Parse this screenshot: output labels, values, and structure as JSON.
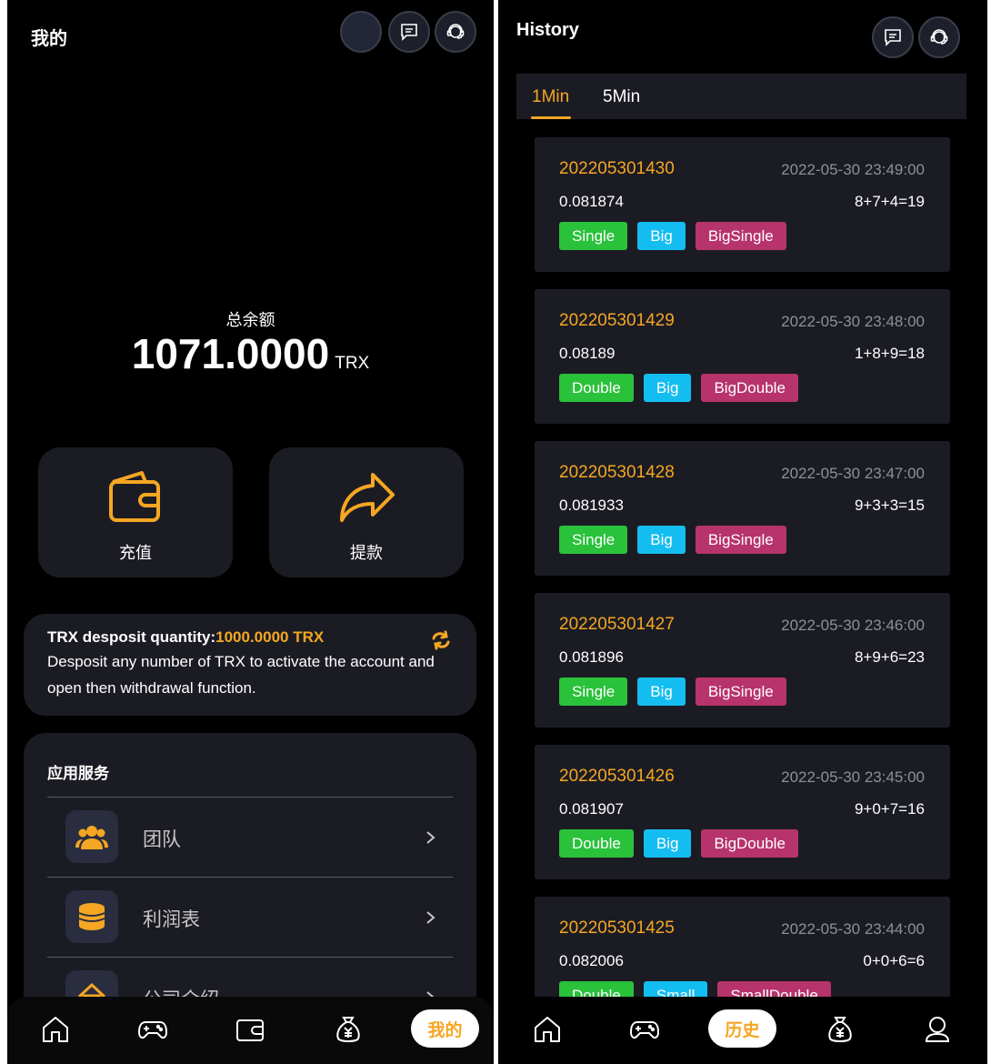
{
  "left": {
    "title": "我的",
    "balance": {
      "label": "总余额",
      "amount": "1071.0000",
      "unit": "TRX"
    },
    "actions": [
      {
        "label": "充值",
        "icon": "wallet-icon"
      },
      {
        "label": "提款",
        "icon": "share-arrow-icon"
      }
    ],
    "notice": {
      "title_prefix": "TRX desposit quantity:",
      "title_value": "1000.0000 TRX",
      "body": "Desposit any number of TRX to activate the account and open then withdrawal function."
    },
    "services": {
      "title": "应用服务",
      "items": [
        {
          "label": "团队",
          "icon": "team-icon"
        },
        {
          "label": "利润表",
          "icon": "coins-icon"
        },
        {
          "label": "公司介绍",
          "icon": "company-icon"
        }
      ]
    },
    "nav_active_label": "我的"
  },
  "right": {
    "title": "History",
    "tabs": [
      {
        "label": "1Min"
      },
      {
        "label": "5Min"
      }
    ],
    "records": [
      {
        "issue": "202205301430",
        "time": "2022-05-30 23:49:00",
        "hash": "0.081874",
        "sum": "8+7+4=19",
        "tags": [
          "Single",
          "Big",
          "BigSingle"
        ]
      },
      {
        "issue": "202205301429",
        "time": "2022-05-30 23:48:00",
        "hash": "0.08189",
        "sum": "1+8+9=18",
        "tags": [
          "Double",
          "Big",
          "BigDouble"
        ]
      },
      {
        "issue": "202205301428",
        "time": "2022-05-30 23:47:00",
        "hash": "0.081933",
        "sum": "9+3+3=15",
        "tags": [
          "Single",
          "Big",
          "BigSingle"
        ]
      },
      {
        "issue": "202205301427",
        "time": "2022-05-30 23:46:00",
        "hash": "0.081896",
        "sum": "8+9+6=23",
        "tags": [
          "Single",
          "Big",
          "BigSingle"
        ]
      },
      {
        "issue": "202205301426",
        "time": "2022-05-30 23:45:00",
        "hash": "0.081907",
        "sum": "9+0+7=16",
        "tags": [
          "Double",
          "Big",
          "BigDouble"
        ]
      },
      {
        "issue": "202205301425",
        "time": "2022-05-30 23:44:00",
        "hash": "0.082006",
        "sum": "0+0+6=6",
        "tags": [
          "Double",
          "Small",
          "SmallDouble"
        ]
      }
    ],
    "nav_active_label": "历史"
  },
  "colors": {
    "accent": "#f5a623",
    "card": "#1b1c23",
    "tag_green": "#2ac13b",
    "tag_blue": "#14bdf0",
    "tag_pink": "#b7336b"
  }
}
